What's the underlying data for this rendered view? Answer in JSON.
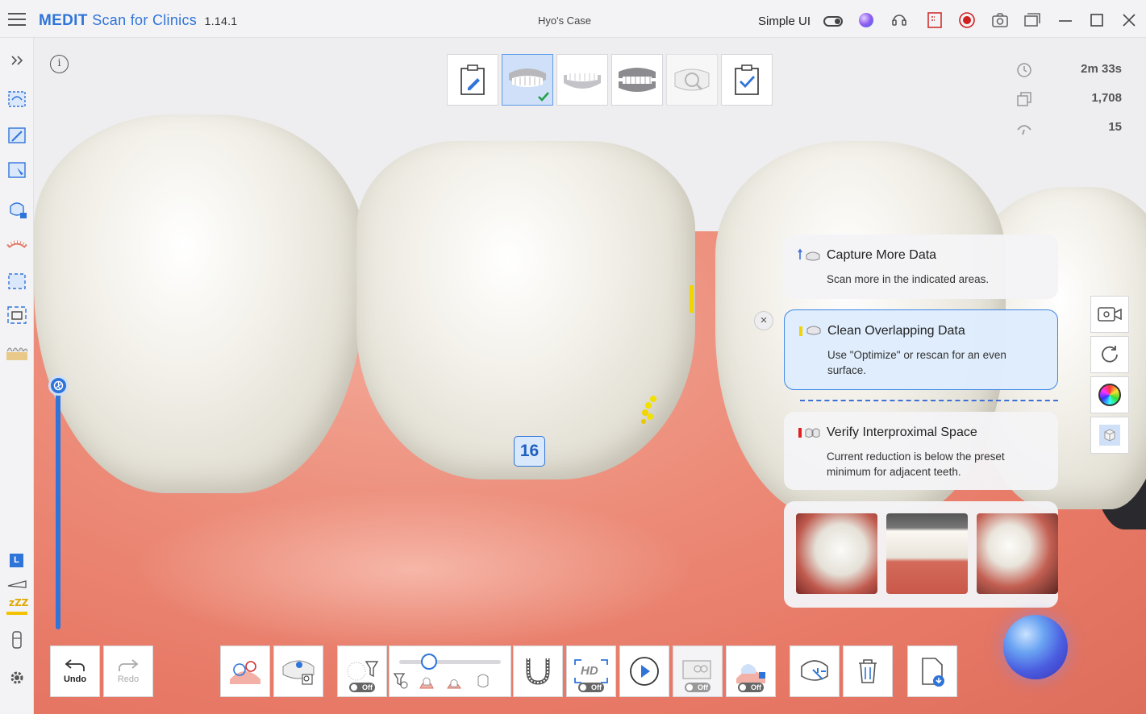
{
  "app": {
    "brand": "MEDIT",
    "product": "Scan for Clinics",
    "version": "1.14.1",
    "case_title": "Hyo's Case",
    "simple_ui_label": "Simple UI",
    "simple_ui_on": false
  },
  "titlebar_icons": [
    "ai-orb-icon",
    "support-headset-icon",
    "screen-capture-icon",
    "record-icon",
    "camera-icon",
    "gallery-icon"
  ],
  "window_controls": [
    "minimize-icon",
    "maximize-icon",
    "close-icon"
  ],
  "sidebar": {
    "items": [
      "expand-icon",
      "scan-region-icon",
      "edit-icon",
      "edit-area-icon",
      "tooth-lock-icon",
      "arch-icon",
      "margin-icon",
      "photo-icon",
      "tooth-library-icon"
    ],
    "bottom": {
      "lower_label": "L"
    }
  },
  "stages": [
    {
      "name": "prep-form-icon",
      "active": false,
      "dim": false
    },
    {
      "name": "maxilla-icon",
      "active": true,
      "dim": false,
      "complete": true
    },
    {
      "name": "mandible-icon",
      "active": false,
      "dim": false
    },
    {
      "name": "occlusion-icon",
      "active": false,
      "dim": false
    },
    {
      "name": "analysis-icon",
      "active": false,
      "dim": true
    },
    {
      "name": "complete-icon",
      "active": false,
      "dim": false
    }
  ],
  "stats": {
    "time": "2m 33s",
    "frames": "1,708",
    "count": "15"
  },
  "tooth_number": "16",
  "feedback": {
    "cards": [
      {
        "title": "Capture More Data",
        "body": "Scan more in the indicated areas.",
        "marker": "#3f70d8",
        "selected": false
      },
      {
        "title": "Clean Overlapping Data",
        "body": "Use \"Optimize\" or rescan for an even surface.",
        "marker": "#f2d400",
        "selected": true
      },
      {
        "title": "Verify Interproximal Space",
        "body": "Current reduction is below the preset minimum for adjacent teeth.",
        "marker": "#e02020",
        "selected": false
      }
    ],
    "close": "×"
  },
  "right_tools": [
    "video-icon",
    "reset-view-icon",
    "color-wheel-icon",
    "solid-view-icon"
  ],
  "toolbar": {
    "undo_label": "Undo",
    "redo_label": "Redo",
    "hd_label": "HD",
    "off_label": "Off",
    "filter_slider_level": 0.35
  },
  "slider": {
    "level": 1.0
  }
}
